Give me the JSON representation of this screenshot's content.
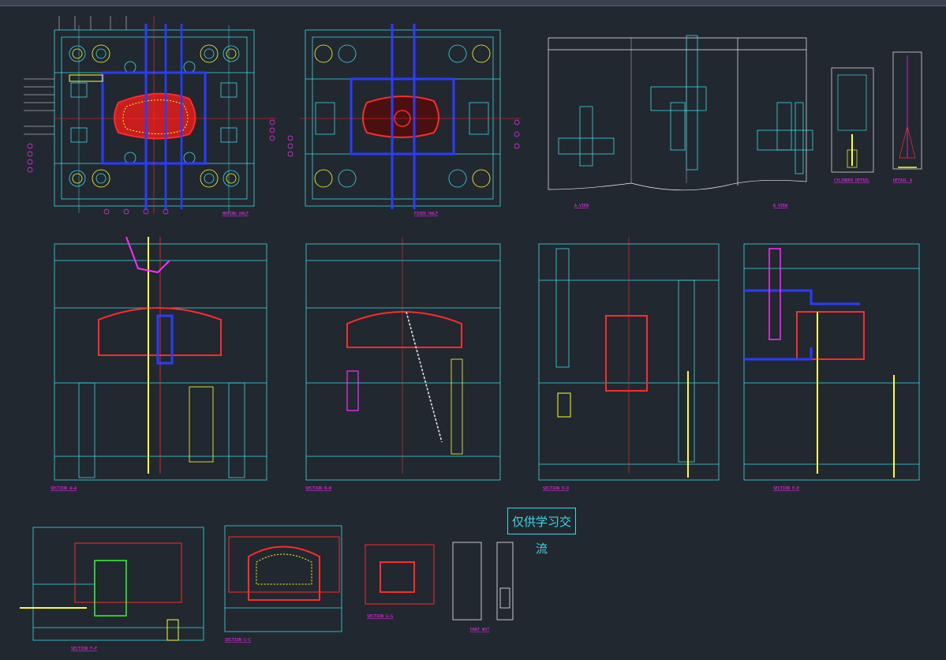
{
  "watermark": "仅供学习交流",
  "view_labels": {
    "moving_half": "MOVING HALF",
    "fixed_half": "FIXED HALF",
    "a_view": "A VIEW",
    "b_view": "B VIEW",
    "cyl_detail": "CYLINDER DETAIL",
    "detail_a": "DETAIL A",
    "section_aa": "SECTION A—A",
    "section_bb": "SECTION B—B",
    "section_dd": "SECTION D—D",
    "section_ee": "SECTION E—E",
    "section_ff": "SECTION F—F",
    "section_cc": "SECTION C—C",
    "section_gg": "SECTION G—G",
    "part": "PART #37"
  },
  "colors": {
    "background": "#212830",
    "cyan": "#3fd8e6",
    "red": "#ff2a2a",
    "yellow": "#ffff2a",
    "blue": "#2a3cff",
    "magenta": "#ff2bff",
    "white": "#f0f0f0",
    "green": "#2aff2a"
  }
}
